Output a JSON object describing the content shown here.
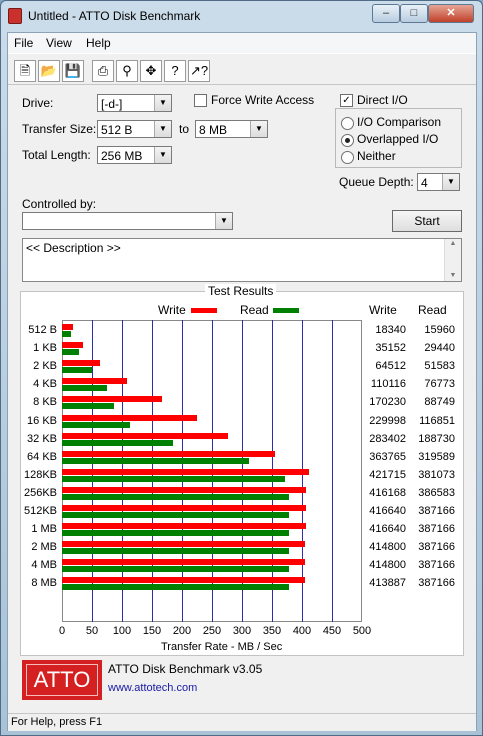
{
  "window": {
    "title": "Untitled - ATTO Disk Benchmark"
  },
  "menu": [
    "File",
    "View",
    "Help"
  ],
  "toolbar": [
    "new-icon",
    "open-icon",
    "save-icon",
    "print-icon",
    "print-preview-icon",
    "move-icon",
    "help-icon",
    "context-help-icon"
  ],
  "settings": {
    "drive_label": "Drive:",
    "drive_value": "[-d-]",
    "transfer_size_label": "Transfer Size:",
    "transfer_from": "512 B",
    "to_label": "to",
    "transfer_to": "8 MB",
    "total_length_label": "Total Length:",
    "total_length": "256 MB",
    "force_write_access": "Force Write Access",
    "direct_io": "Direct I/O",
    "io_comparison": "I/O Comparison",
    "overlapped_io": "Overlapped I/O",
    "neither": "Neither",
    "queue_depth_label": "Queue Depth:",
    "queue_depth": "4",
    "controlled_by_label": "Controlled by:",
    "controlled_by_value": "",
    "start_label": "Start",
    "description": "<< Description >>"
  },
  "results": {
    "title": "Test Results",
    "legend_write": "Write",
    "legend_read": "Read",
    "col_write": "Write",
    "col_read": "Read",
    "xlabel": "Transfer Rate - MB / Sec",
    "write_color": "#ff0000",
    "read_color": "#008000"
  },
  "chart_data": {
    "type": "bar",
    "orientation": "horizontal",
    "title": "Test Results",
    "xlabel": "Transfer Rate - MB / Sec",
    "xlim": [
      0,
      500
    ],
    "xticks": [
      "0",
      "50",
      "100",
      "150",
      "200",
      "250",
      "300",
      "350",
      "400",
      "450",
      "500"
    ],
    "categories": [
      "512 B",
      "1 KB",
      "2 KB",
      "4 KB",
      "8 KB",
      "16 KB",
      "32 KB",
      "64 KB",
      "128KB",
      "256KB",
      "512KB",
      "1 MB",
      "2 MB",
      "4 MB",
      "8 MB"
    ],
    "series": [
      {
        "name": "Write",
        "values": [
          18340,
          35152,
          64512,
          110116,
          170230,
          229998,
          283402,
          363765,
          421715,
          416168,
          416640,
          416640,
          414800,
          414800,
          413887
        ]
      },
      {
        "name": "Read",
        "values": [
          15960,
          29440,
          51583,
          76773,
          88749,
          116851,
          188730,
          319589,
          381073,
          386583,
          387166,
          387166,
          387166,
          387166,
          387166
        ]
      }
    ],
    "write_values_text": [
      "18340",
      "35152",
      "64512",
      "110116",
      "170230",
      "229998",
      "283402",
      "363765",
      "421715",
      "416168",
      "416640",
      "416640",
      "414800",
      "414800",
      "413887"
    ],
    "read_values_text": [
      "15960",
      "29440",
      "51583",
      "76773",
      "88749",
      "116851",
      "188730",
      "319589",
      "381073",
      "386583",
      "387166",
      "387166",
      "387166",
      "387166",
      "387166"
    ]
  },
  "footer": {
    "logo_text": "ATTO",
    "product": "ATTO Disk Benchmark v3.05",
    "url": "www.attotech.com"
  },
  "status": "For Help, press F1"
}
